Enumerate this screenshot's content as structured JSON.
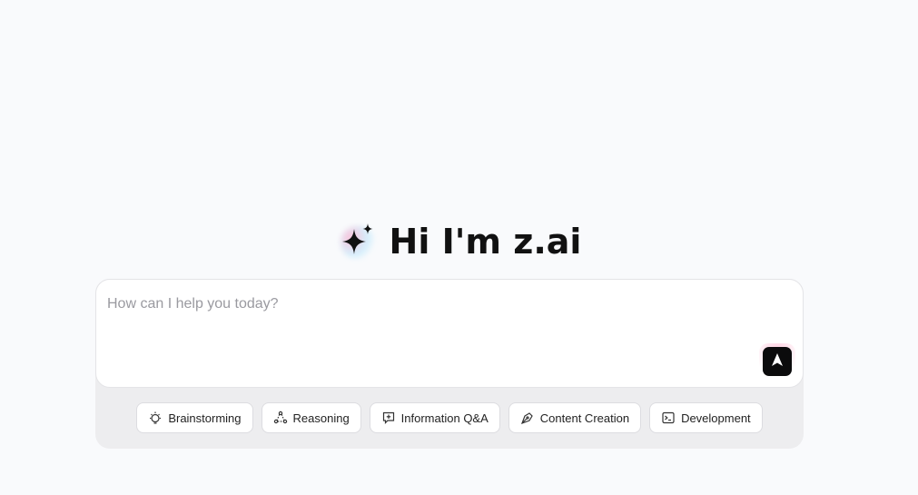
{
  "greeting": {
    "title": "Hi I'm z.ai",
    "icon": "sparkle-icon"
  },
  "composer": {
    "placeholder": "How can I help you today?",
    "value": "",
    "send_icon": "send-arrow-icon"
  },
  "chips": [
    {
      "label": "Brainstorming",
      "icon": "lightbulb-icon"
    },
    {
      "label": "Reasoning",
      "icon": "nodes-icon"
    },
    {
      "label": "Information Q&A",
      "icon": "chat-plus-icon"
    },
    {
      "label": "Content Creation",
      "icon": "pen-nib-icon"
    },
    {
      "label": "Development",
      "icon": "terminal-icon"
    }
  ],
  "colors": {
    "background": "#f9fafc",
    "composer_shell": "#ededef",
    "send_button": "#0b0b0c"
  }
}
